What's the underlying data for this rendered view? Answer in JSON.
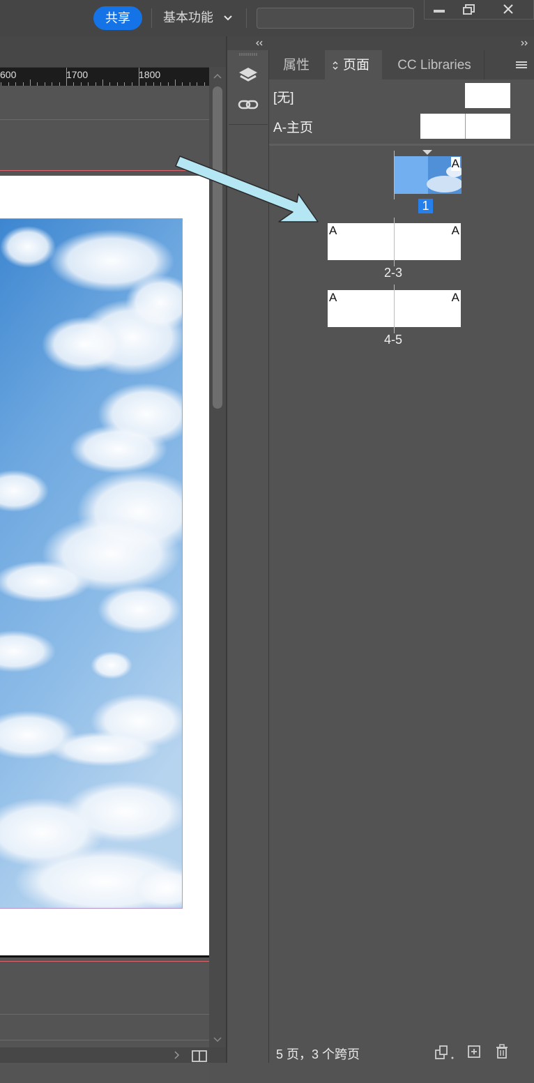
{
  "topbar": {
    "share_label": "共享",
    "workspace_label": "基本功能",
    "search_value": ""
  },
  "ruler": {
    "labels": [
      "600",
      "1700",
      "1800"
    ]
  },
  "strip": {
    "icons": [
      "layers-icon",
      "link-icon"
    ]
  },
  "panel": {
    "tabs": [
      "属性",
      "页面",
      "CC Libraries"
    ],
    "active_tab": "页面",
    "masters": [
      {
        "label": "[无]"
      },
      {
        "label": "A-主页"
      }
    ],
    "pages": [
      {
        "number": "1",
        "master": "A",
        "selected": true
      },
      {
        "number": "2-3",
        "master_left": "A",
        "master_right": "A"
      },
      {
        "number": "4-5",
        "master_left": "A",
        "master_right": "A"
      }
    ],
    "status": "5 页，3 个跨页"
  },
  "colors": {
    "accent": "#1473e6",
    "panel_bg": "#535353",
    "selection": "#2680eb",
    "annotation_arrow": "#b4e6f4"
  }
}
